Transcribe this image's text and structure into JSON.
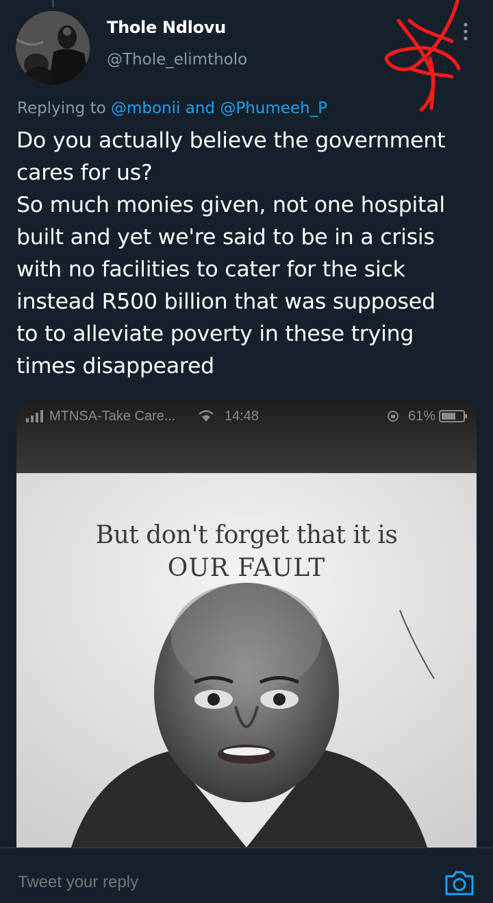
{
  "tweet": {
    "display_name": "Thole Ndlovu",
    "handle": "@Thole_elimtholo",
    "replying_prefix": "Replying to",
    "replying_user1": "@mbonii",
    "replying_and": "and",
    "replying_user2": "@Phumeeh_P",
    "text_lines": [
      "Do you actually believe the government",
      "cares for us?",
      "So much monies given, not one hospital",
      "built and yet we're said to be in a crisis",
      "with no facilities to cater for the sick",
      "instead R500 billion that was supposed",
      "to to alleviate poverty in these trying",
      "times disappeared"
    ]
  },
  "media": {
    "status_bar": {
      "carrier": "MTNSA-Take Care...",
      "time": "14:48",
      "battery": "61%"
    },
    "headline_line1": "But don't forget that it is",
    "headline_line2": "OUR FAULT"
  },
  "reply": {
    "placeholder": "Tweet your reply"
  },
  "icons": {
    "more": "more-vertical-icon",
    "camera": "camera-icon",
    "signal": "signal-icon",
    "wifi": "wifi-icon",
    "battery": "battery-icon",
    "rotation_lock": "rotation-lock-icon"
  },
  "colors": {
    "background": "#15202b",
    "accent": "#1da1f2",
    "muted": "#8899a6",
    "annotation": "#ff1a1a"
  }
}
